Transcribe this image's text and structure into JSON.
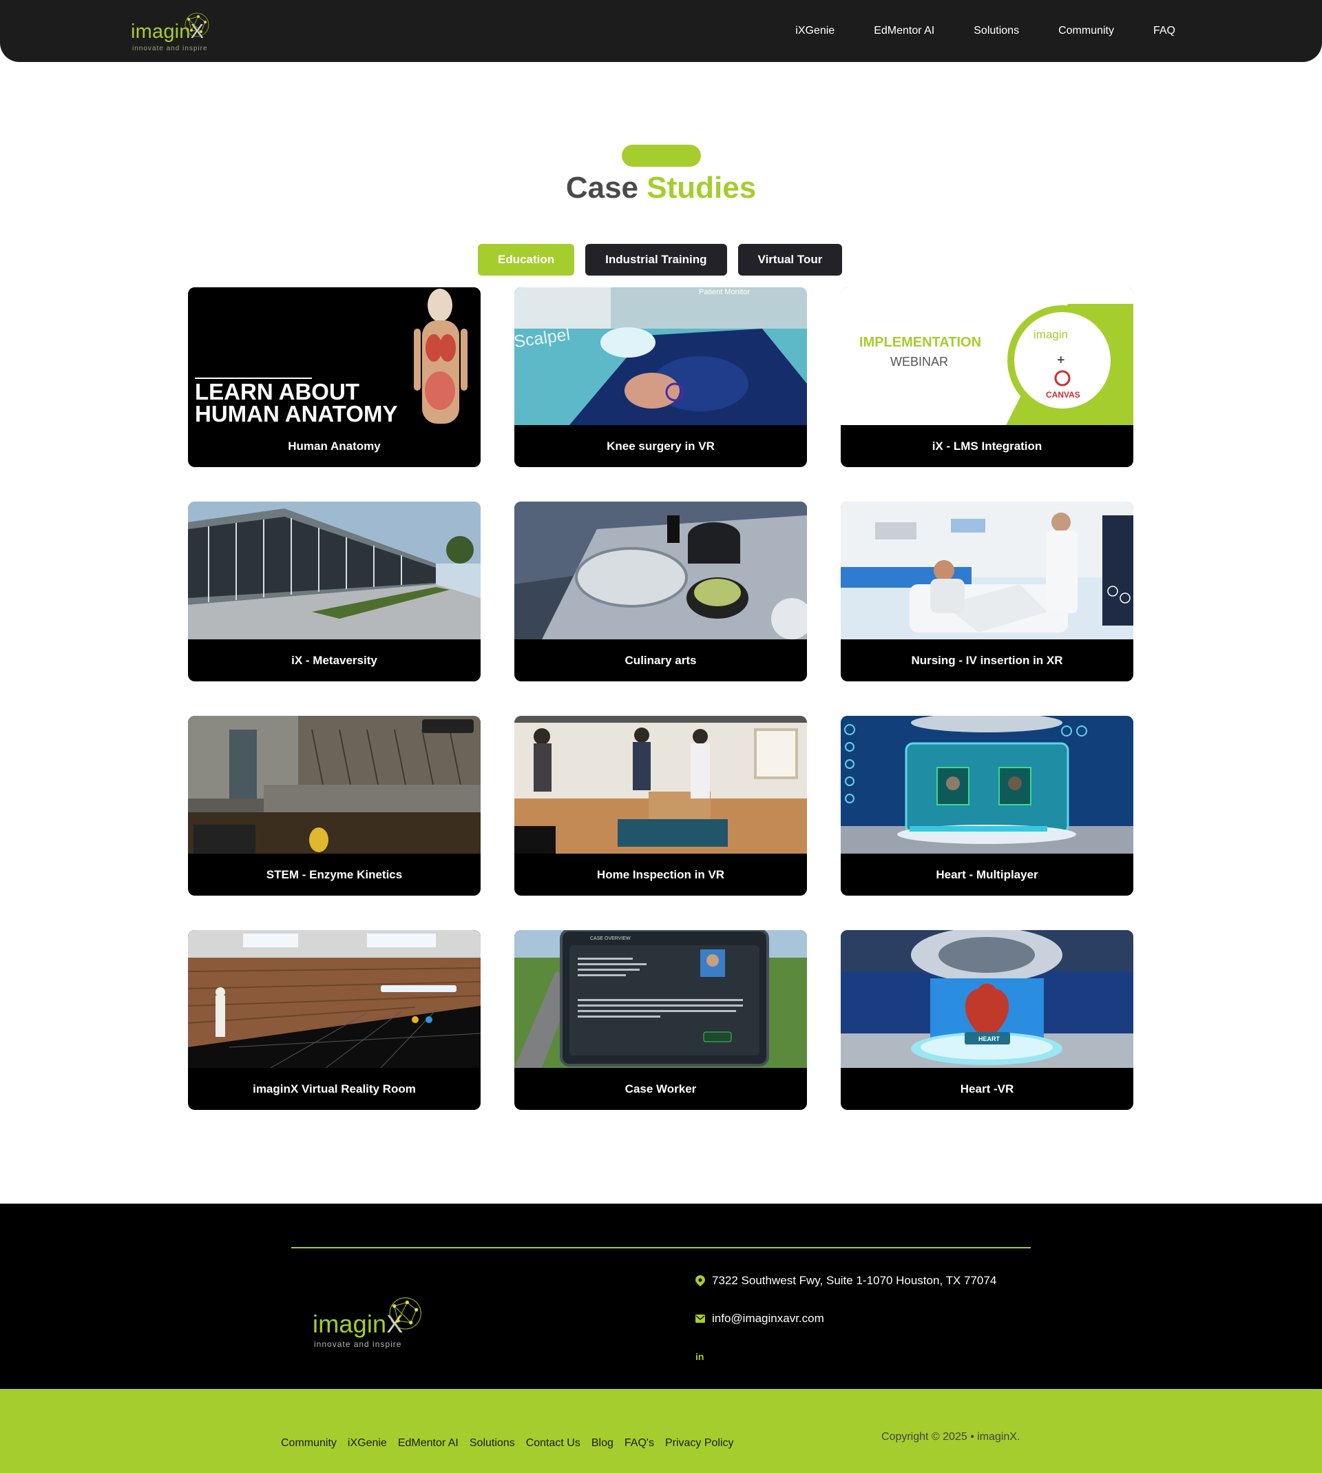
{
  "brand": {
    "name": "imagin",
    "x": "X",
    "tagline": "innovate and inspire"
  },
  "nav": [
    "iXGenie",
    "EdMentor AI",
    "Solutions",
    "Community",
    "FAQ"
  ],
  "section": {
    "title_dark": "Case Studies",
    "title_main": "Case",
    "title_accent": "Studies"
  },
  "tabs": [
    {
      "label": "Education",
      "active": true
    },
    {
      "label": "Industrial Training",
      "active": false
    },
    {
      "label": "Virtual Tour",
      "active": false
    }
  ],
  "cards": [
    {
      "label": "Human Anatomy",
      "thumb_text": [
        "LEARN ABOUT",
        "HUMAN ANATOMY"
      ]
    },
    {
      "label": "Knee surgery in VR",
      "thumb_text": [
        "Scalpel",
        "Patient Monitor"
      ]
    },
    {
      "label": "iX - LMS Integration",
      "thumb_text": [
        "IMPLEMENTATION",
        "WEBINAR",
        "imagin",
        "+",
        "CANVAS"
      ]
    },
    {
      "label": "iX - Metaversity"
    },
    {
      "label": "Culinary arts"
    },
    {
      "label": "Nursing - IV insertion in XR"
    },
    {
      "label": "STEM - Enzyme Kinetics"
    },
    {
      "label": "Home Inspection in VR"
    },
    {
      "label": "Heart - Multiplayer"
    },
    {
      "label": "imaginX Virtual Reality Room"
    },
    {
      "label": "Case Worker",
      "thumb_text": [
        "CASE OVERVIEW"
      ]
    },
    {
      "label": "Heart -VR",
      "thumb_text": [
        "HEART"
      ]
    }
  ],
  "footer": {
    "address": "7322 Southwest Fwy, Suite 1-1070 Houston, TX 77074",
    "email": "info@imaginxavr.com",
    "social": "in",
    "links": [
      "Community",
      "iXGenie",
      "EdMentor AI",
      "Solutions",
      "Contact Us",
      "Blog",
      "FAQ's",
      "Privacy Policy"
    ],
    "copyright": "Copyright © 2025 • imaginX."
  },
  "colors": {
    "accent": "#a6cd2e",
    "dark": "#1c1c1c",
    "tab_dark": "#222228"
  }
}
